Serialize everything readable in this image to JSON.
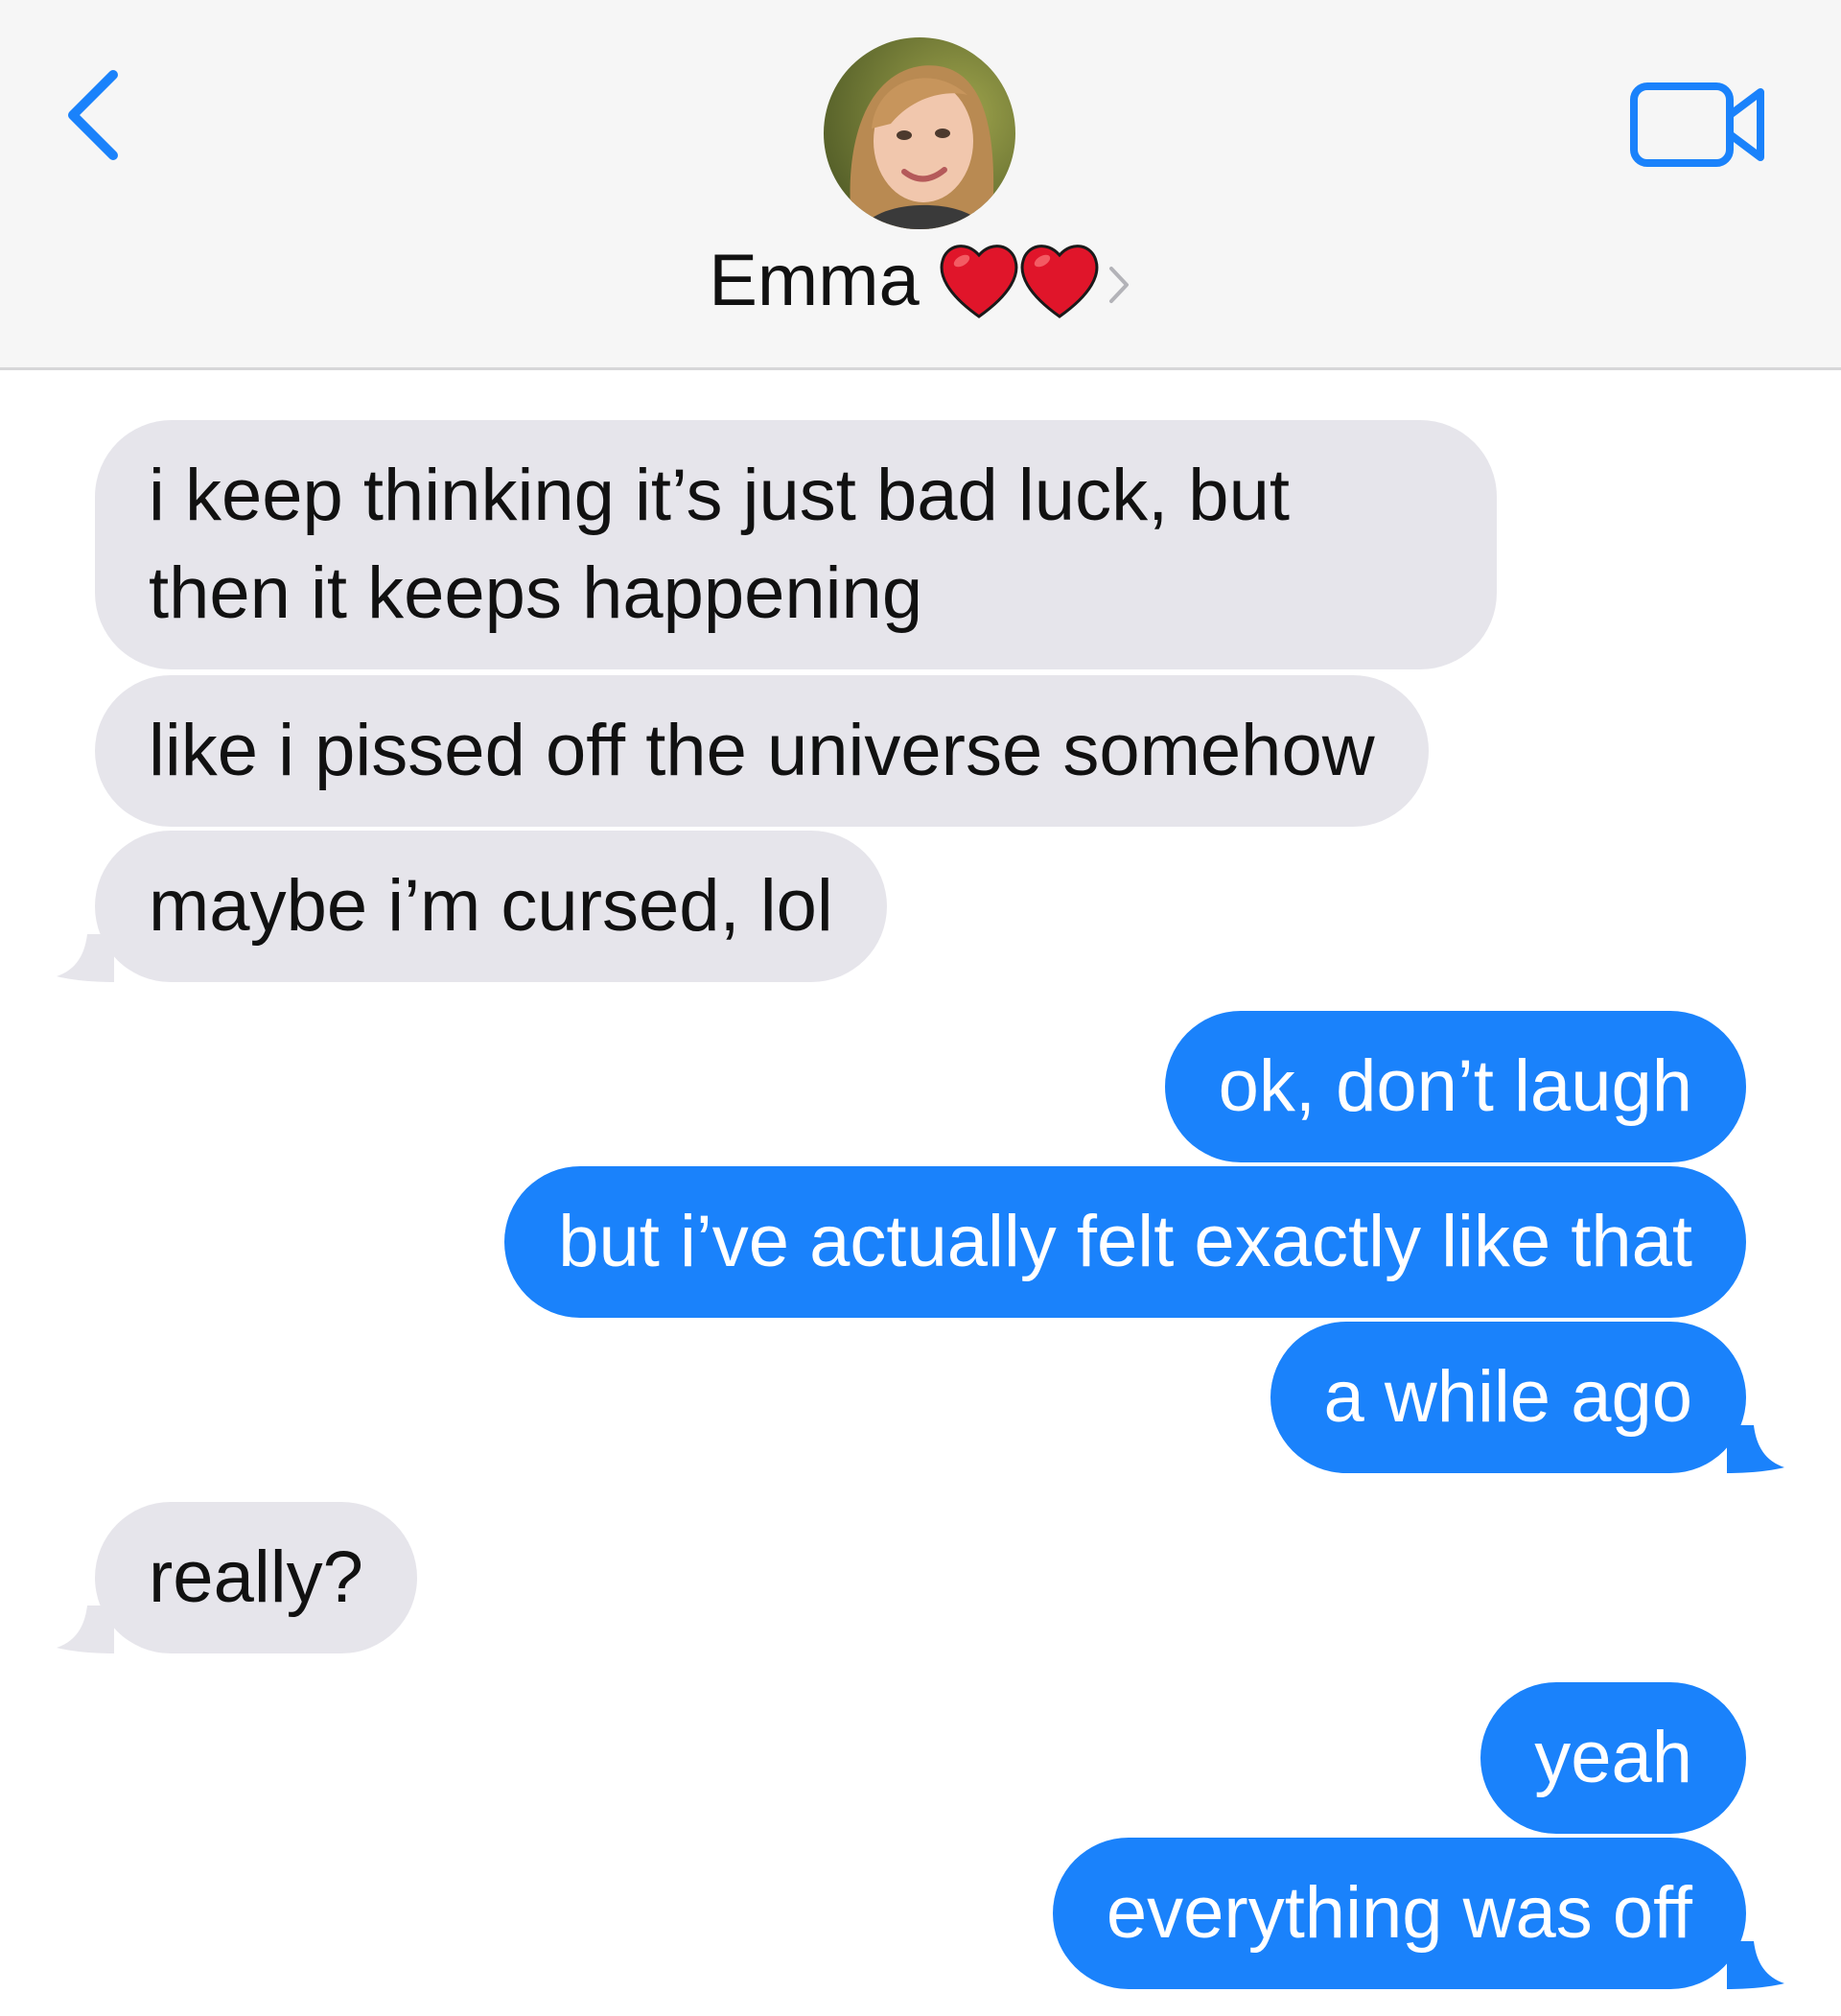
{
  "header": {
    "contact_name": "Emma",
    "heart_emoji": "❤️❤️",
    "back_icon": "chevron-left-icon",
    "video_icon": "video-camera-icon",
    "accent_color": "#1a82fb"
  },
  "messages": [
    {
      "sender": "contact",
      "text": "i keep thinking it’s just bad luck, but then it keeps happening"
    },
    {
      "sender": "contact",
      "text": "like i pissed off the universe somehow"
    },
    {
      "sender": "contact",
      "text": "maybe i’m cursed, lol"
    },
    {
      "sender": "me",
      "text": "ok, don’t laugh"
    },
    {
      "sender": "me",
      "text": "but i’ve actually felt exactly like that"
    },
    {
      "sender": "me",
      "text": "a while ago"
    },
    {
      "sender": "contact",
      "text": "really?"
    },
    {
      "sender": "me",
      "text": "yeah"
    },
    {
      "sender": "me",
      "text": "everything was off"
    }
  ],
  "colors": {
    "incoming_bubble": "#e6e5eb",
    "outgoing_bubble": "#1a82fb",
    "header_background": "#f6f6f6"
  }
}
